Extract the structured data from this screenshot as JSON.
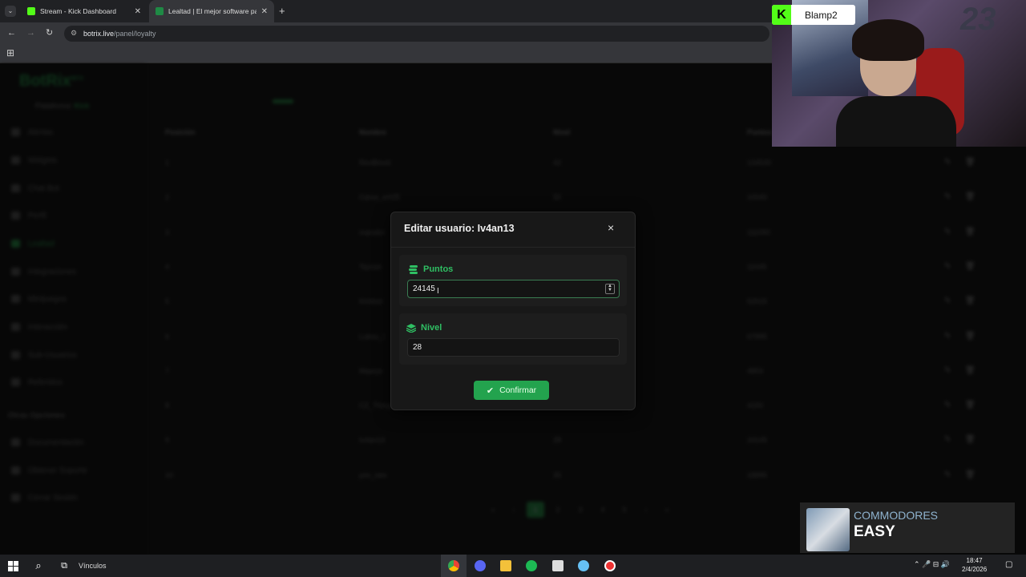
{
  "browser": {
    "tabs": [
      {
        "title": "Stream - Kick Dashboard",
        "favicon_color": "#53fc18"
      },
      {
        "title": "Lealtad | El mejor software para",
        "favicon_color": "#1f8a45"
      }
    ],
    "url_host": "botrix.live",
    "url_path": "/panel/loyalty",
    "bookmarks_apps_icon": "apps-grid-icon"
  },
  "sidebar": {
    "logo": "BotRix",
    "logo_badge": "BETA",
    "platform_label": "Plataforma:",
    "platform_value": "Kick",
    "items": [
      {
        "label": "Alertas"
      },
      {
        "label": "Widgets"
      },
      {
        "label": "Chat Bot"
      },
      {
        "label": "Perfil"
      },
      {
        "label": "Lealtad"
      },
      {
        "label": "Integraciones"
      },
      {
        "label": "Minijuegos"
      },
      {
        "label": "Interacción"
      },
      {
        "label": "Sub-Usuarios"
      },
      {
        "label": "Referidos"
      }
    ],
    "section_other": "Otras Opciones",
    "other_items": [
      {
        "label": "Documentación"
      },
      {
        "label": "Obtener Soporte"
      },
      {
        "label": "Cerrar Sesión"
      }
    ]
  },
  "table": {
    "headers": [
      "Posición",
      "Nombre",
      "Nivel",
      "Puntos"
    ],
    "rows": [
      {
        "pos": "1",
        "name": "RevBlood",
        "level": "42",
        "points": "134530"
      },
      {
        "pos": "2",
        "name": "Carso_xm05",
        "level": "50",
        "points": "10040"
      },
      {
        "pos": "3",
        "name": "mansbri",
        "level": "",
        "points": "111090"
      },
      {
        "pos": "4",
        "name": "Tazcon",
        "level": "",
        "points": "11045"
      },
      {
        "pos": "5",
        "name": "Kickbot",
        "level": "",
        "points": "52615"
      },
      {
        "pos": "6",
        "name": "Lukou_l",
        "level": "",
        "points": "67895"
      },
      {
        "pos": "7",
        "name": "Maarys",
        "level": "",
        "points": "4853"
      },
      {
        "pos": "8",
        "name": "CZ_Thing",
        "level": "",
        "points": "4150"
      },
      {
        "pos": "9",
        "name": "Iv4an13",
        "level": "28",
        "points": "24145"
      },
      {
        "pos": "10",
        "name": "yon_nen",
        "level": "35",
        "points": "18895"
      }
    ],
    "pagination": [
      "«",
      "‹",
      "1",
      "2",
      "3",
      "4",
      "5",
      "›",
      "»"
    ]
  },
  "modal": {
    "title": "Editar usuario: Iv4an13",
    "close": "×",
    "points_label": "Puntos",
    "points_value": "24145",
    "level_label": "Nivel",
    "level_value": "28",
    "confirm_label": "Confirmar",
    "accent": "#23a34e"
  },
  "overlay": {
    "kick_name": "Blamp2",
    "kick_logo": "K",
    "cam_number": "23",
    "album_artist": "COMMODORES",
    "album_title": "EASY"
  },
  "taskbar": {
    "links_label": "Vínculos",
    "time": "18:47",
    "date": "2/4/2026"
  }
}
